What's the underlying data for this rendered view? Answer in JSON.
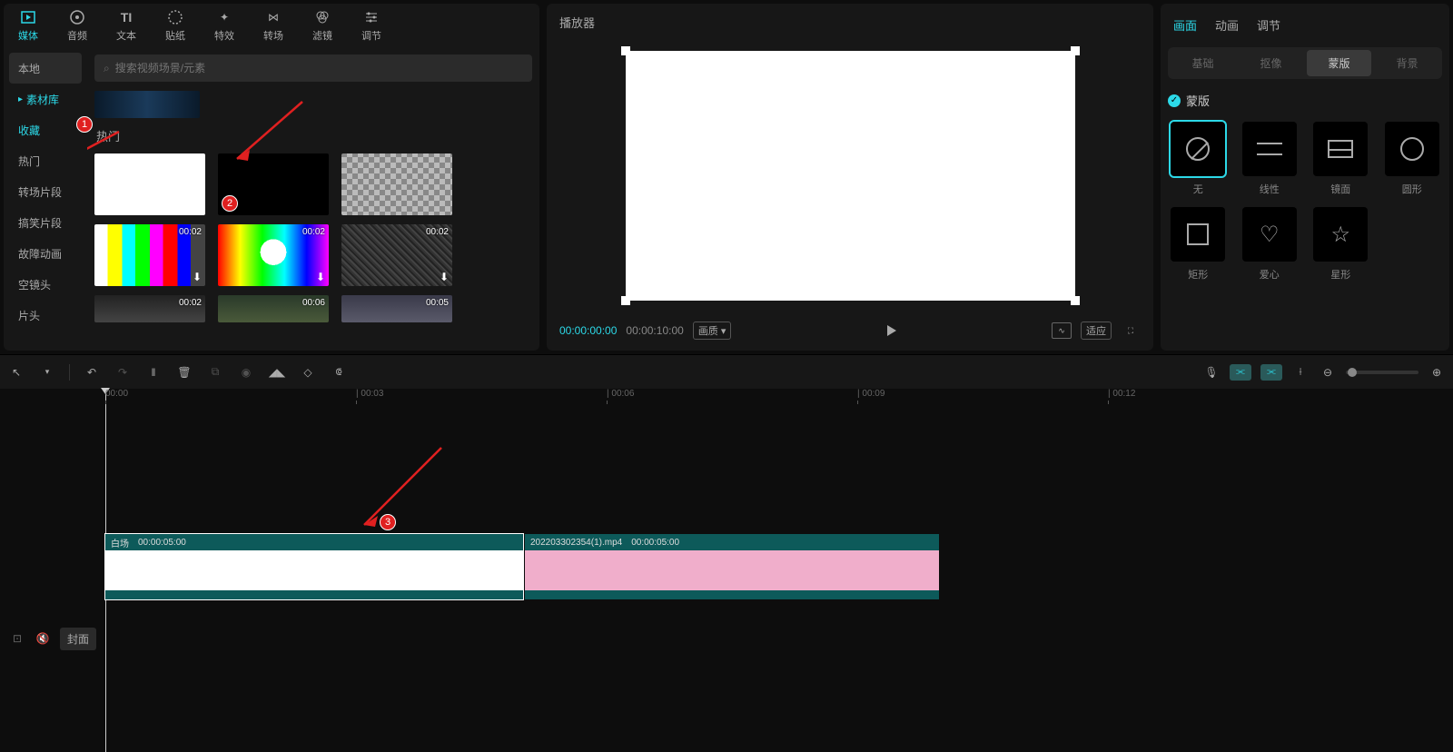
{
  "top_tabs": [
    "媒体",
    "音频",
    "文本",
    "贴纸",
    "特效",
    "转场",
    "滤镜",
    "调节"
  ],
  "media_sidebar": {
    "local": "本地",
    "lib": "素材库",
    "fav": "收藏",
    "hot": "热门",
    "trans": "转场片段",
    "funny": "搞笑片段",
    "glitch": "故障动画",
    "empty": "空镜头",
    "opening": "片头"
  },
  "search_placeholder": "搜索视频场景/元素",
  "section_hot": "热门",
  "thumbs": {
    "d1": "00:02",
    "d2": "00:02",
    "d3": "00:02",
    "d4": "00:02",
    "d5": "00:06",
    "d6": "00:05"
  },
  "player": {
    "title": "播放器",
    "cur": "00:00:00:00",
    "dur": "00:00:10:00",
    "quality": "画质",
    "fit": "适应"
  },
  "props": {
    "tabs": [
      "画面",
      "动画",
      "调节"
    ],
    "subtabs": [
      "基础",
      "抠像",
      "蒙版",
      "背景"
    ],
    "mask_check": "蒙版",
    "masks": [
      "无",
      "线性",
      "镜面",
      "圆形",
      "矩形",
      "爱心",
      "星形"
    ]
  },
  "ruler": [
    "00:00",
    "00:03",
    "00:06",
    "00:09",
    "00:12"
  ],
  "clips": {
    "c1_name": "白场",
    "c1_dur": "00:00:05:00",
    "c2_name": "202203302354(1).mp4",
    "c2_dur": "00:00:05:00"
  },
  "cover": "封面",
  "annotations": {
    "n1": "1",
    "n2": "2",
    "n3": "3"
  }
}
